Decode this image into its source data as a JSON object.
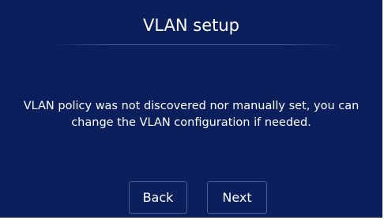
{
  "dialog": {
    "title": "VLAN setup",
    "message": "VLAN policy was not discovered nor manually set, you can change the VLAN configuration if needed."
  },
  "buttons": {
    "back_label": "Back",
    "next_label": "Next"
  },
  "colors": {
    "background": "#0b1f5c",
    "text": "#ffffff",
    "button_border": "#4a5d93"
  }
}
